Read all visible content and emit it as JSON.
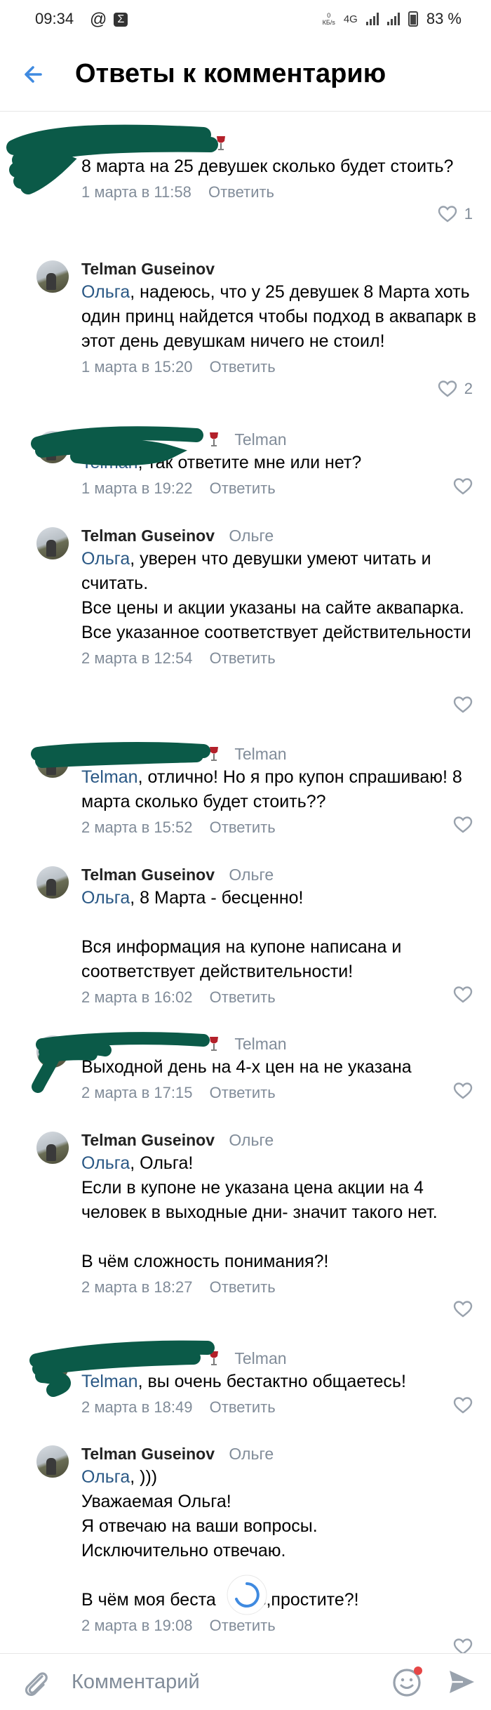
{
  "status_bar": {
    "time": "09:34",
    "net_speed_value": "0",
    "net_speed_unit": "КБ/s",
    "network": "4G",
    "battery": "83 %"
  },
  "header": {
    "title": "Ответы к комментарию"
  },
  "comments": [
    {
      "author": "",
      "reply_to": "",
      "mention": "",
      "text": "8 марта на 25 девушек сколько будет стоить?",
      "date": "1 марта в 11:58",
      "reply_label": "Ответить",
      "likes": "1"
    },
    {
      "author": "Telman Guseinov",
      "reply_to": "",
      "mention": "Ольга",
      "text": ", надеюсь, что у 25 девушек 8 Марта хоть один принц найдется чтобы подход в аквапарк в этот день девушкам ничего не стоил!",
      "date": "1 марта в 15:20",
      "reply_label": "Ответить",
      "likes": "2"
    },
    {
      "author": "",
      "reply_to": "Telman",
      "mention": "Telman",
      "text": ", так ответите мне или нет?",
      "date": "1 марта в 19:22",
      "reply_label": "Ответить",
      "likes": ""
    },
    {
      "author": "Telman Guseinov",
      "reply_to": "Ольге",
      "mention": "Ольга",
      "text": ", уверен что девушки умеют читать и считать.\nВсе цены и акции указаны на сайте аквапарка.\nВсе указанное соответствует действительности",
      "date": "2 марта в 12:54",
      "reply_label": "Ответить",
      "likes": ""
    },
    {
      "author": "",
      "reply_to": "Telman",
      "mention": "Telman",
      "text": ", отлично! Но я про купон спрашиваю! 8 марта сколько будет стоить??",
      "date": "2 марта в 15:52",
      "reply_label": "Ответить",
      "likes": ""
    },
    {
      "author": "Telman Guseinov",
      "reply_to": "Ольге",
      "mention": "Ольга",
      "text": ", 8 Марта - бесценно!\n\nВся информация на купоне написана и соответствует действительности!",
      "date": "2 марта в 16:02",
      "reply_label": "Ответить",
      "likes": ""
    },
    {
      "author": "",
      "reply_to": "Telman",
      "mention": "",
      "text": "Выходной день на 4-х цен на не указана",
      "date": "2 марта в 17:15",
      "reply_label": "Ответить",
      "likes": ""
    },
    {
      "author": "Telman Guseinov",
      "reply_to": "Ольге",
      "mention": "Ольга",
      "text": ", Ольга!\nЕсли в купоне не указана цена акции на 4 человек в выходные дни- значит такого нет.\n\nВ чём сложность понимания?!",
      "date": "2 марта в 18:27",
      "reply_label": "Ответить",
      "likes": ""
    },
    {
      "author": "",
      "reply_to": "Telman",
      "mention": "Telman",
      "text": ", вы очень бестактно общаетесь!",
      "date": "2 марта в 18:49",
      "reply_label": "Ответить",
      "likes": ""
    },
    {
      "author": "Telman Guseinov",
      "reply_to": "Ольге",
      "mention": "Ольга",
      "text": ", )))\nУважаемая Ольга!\nЯ отвечаю на ваши вопросы.\nИсключительно отвечаю.\n\nВ чём моя беста     сть,простите?!",
      "date": "2 марта в 19:08",
      "reply_label": "Ответить",
      "likes": ""
    }
  ],
  "composer": {
    "placeholder": "Комментарий"
  },
  "colors": {
    "accent": "#2a5885",
    "meta": "#818c99",
    "back_arrow": "#3f8ae0",
    "scribble": "#0b5a48",
    "wine": "#b3202a"
  }
}
